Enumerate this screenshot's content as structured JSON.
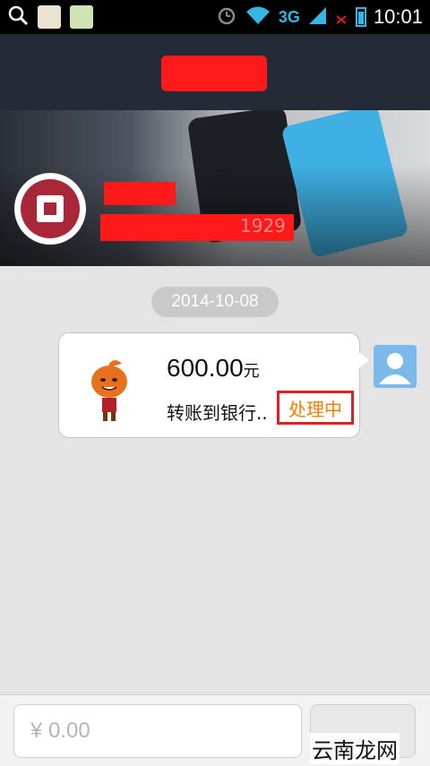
{
  "status_bar": {
    "network": "3G",
    "time": "10:01"
  },
  "chat": {
    "date": "2014-10-08",
    "message": {
      "amount": "600.00",
      "currency": "元",
      "description": "转账到银行..",
      "status": "处理中"
    }
  },
  "header": {
    "account_tail": "1929"
  },
  "input": {
    "placeholder": "¥ 0.00"
  },
  "watermark": "云南龙网",
  "colors": {
    "title_bar": "#242a36",
    "status_text": "#ff7a00",
    "highlight_border": "#e02020",
    "accent_blue": "#34b7e4"
  }
}
